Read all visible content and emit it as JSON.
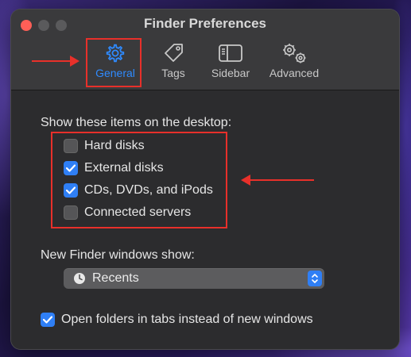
{
  "window": {
    "title": "Finder Preferences"
  },
  "toolbar": {
    "tabs": [
      {
        "label": "General",
        "icon": "gear-icon",
        "selected": true
      },
      {
        "label": "Tags",
        "icon": "tag-icon",
        "selected": false
      },
      {
        "label": "Sidebar",
        "icon": "sidebar-icon",
        "selected": false
      },
      {
        "label": "Advanced",
        "icon": "gears-icon",
        "selected": false
      }
    ]
  },
  "desktop_section": {
    "heading": "Show these items on the desktop:",
    "items": [
      {
        "label": "Hard disks",
        "checked": false
      },
      {
        "label": "External disks",
        "checked": true
      },
      {
        "label": "CDs, DVDs, and iPods",
        "checked": true
      },
      {
        "label": "Connected servers",
        "checked": false
      }
    ]
  },
  "new_window": {
    "label": "New Finder windows show:",
    "selected": "Recents",
    "icon": "clock-icon"
  },
  "tabs_option": {
    "label": "Open folders in tabs instead of new windows",
    "checked": true
  },
  "colors": {
    "accent": "#2f7ff5",
    "annotation": "#e8302a"
  }
}
